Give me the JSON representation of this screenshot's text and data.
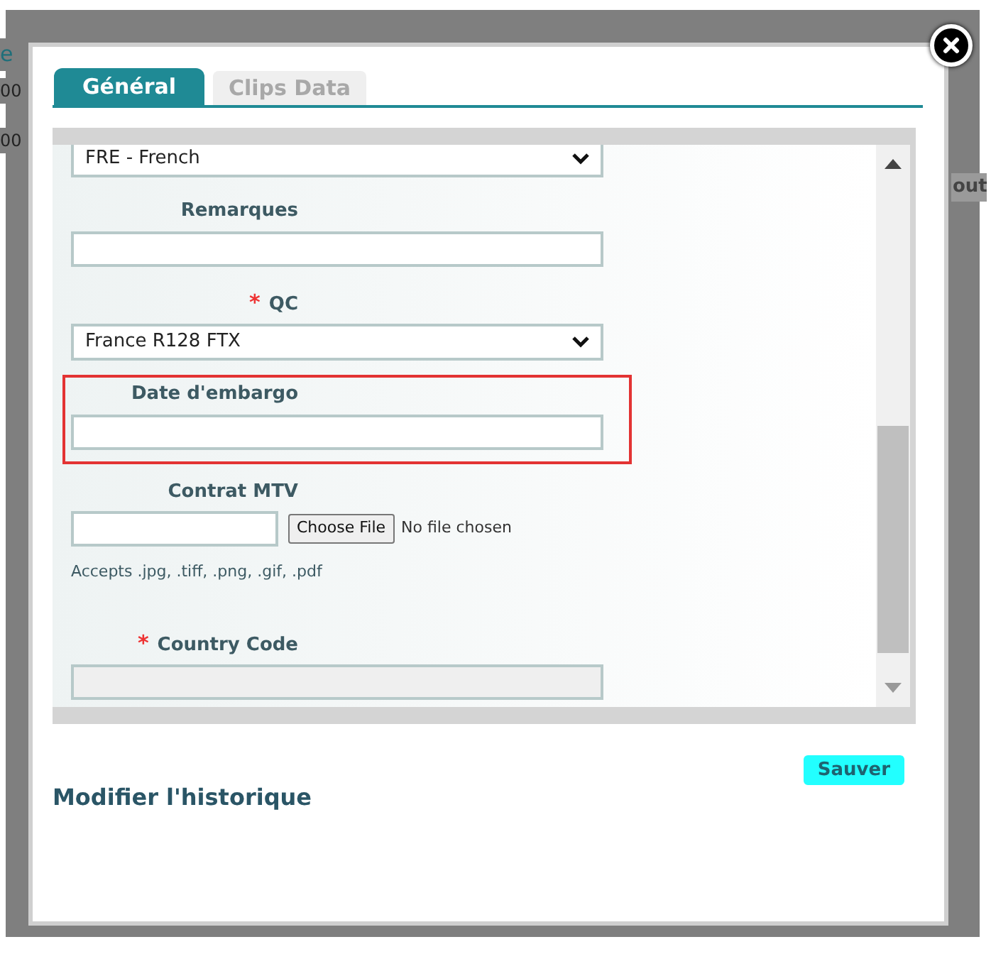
{
  "background_fragments": [
    "e",
    "00",
    "00",
    "out"
  ],
  "tabs": [
    {
      "label": "Général",
      "selected": true
    },
    {
      "label": "Clips Data",
      "selected": false
    }
  ],
  "form": {
    "fields": [
      {
        "kind": "select",
        "value": "FRE - French"
      },
      {
        "kind": "text",
        "label": "Remarques",
        "disabled": false,
        "highlighted": false
      },
      {
        "kind": "select",
        "label": "QC",
        "required_mark": "*",
        "value": "France R128 FTX"
      },
      {
        "kind": "text",
        "label": "Date d'embargo",
        "disabled": false,
        "highlighted": true
      },
      {
        "kind": "file",
        "label": "Contrat MTV",
        "button": "Choose File",
        "status": "No file chosen",
        "hint": "Accepts .jpg, .tiff, .png, .gif, .pdf"
      },
      {
        "kind": "text",
        "label": "Country Code",
        "required_mark": "*",
        "disabled": true,
        "highlighted": false
      }
    ]
  },
  "save_button": "Sauver",
  "section_title": "Modifier l'historique"
}
